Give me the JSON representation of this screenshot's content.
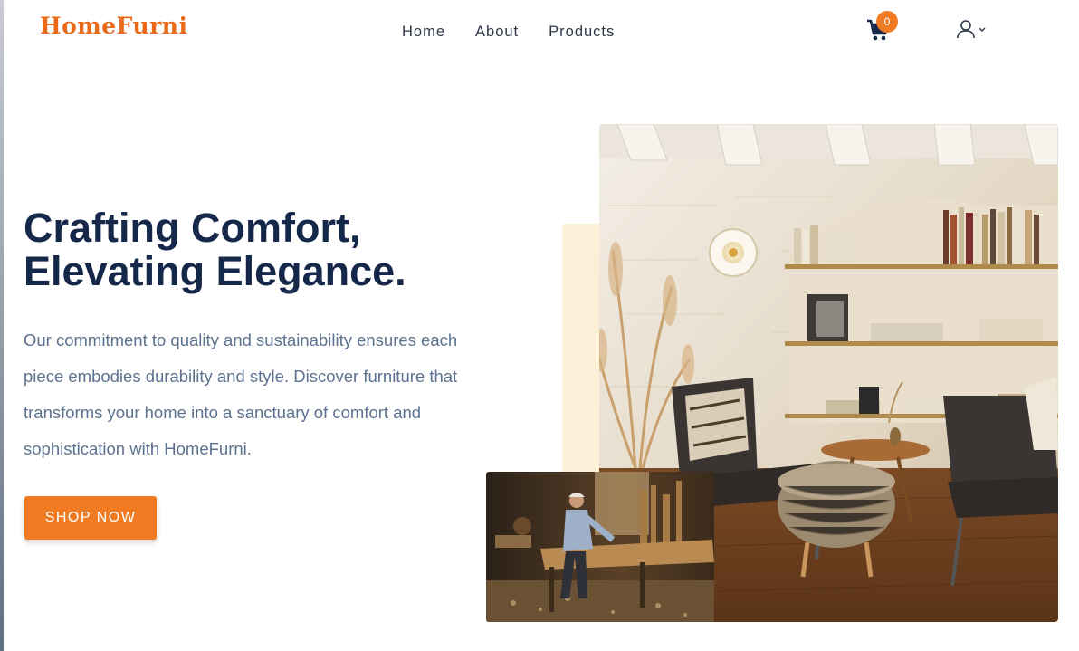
{
  "header": {
    "logo": "HomeFurni",
    "nav": [
      {
        "label": "Home"
      },
      {
        "label": "About"
      },
      {
        "label": "Products"
      }
    ],
    "cart": {
      "icon": "cart-icon",
      "count": "0"
    },
    "user": {
      "icon": "user-icon",
      "dropdown_icon": "chevron-down-icon"
    }
  },
  "hero": {
    "title_line1": "Crafting Comfort,",
    "title_line2": "Elevating Elegance.",
    "description": "Our commitment to quality and sustainability ensures each piece embodies durability and style. Discover furniture that transforms your home into a sanctuary of comfort and sophistication with HomeFurni.",
    "cta": "SHOP NOW"
  },
  "colors": {
    "brand": "#ea6a1a",
    "accent": "#f07b22",
    "heading": "#16284a",
    "body_text": "#5d7290",
    "accent_block": "#fdf0d8"
  }
}
